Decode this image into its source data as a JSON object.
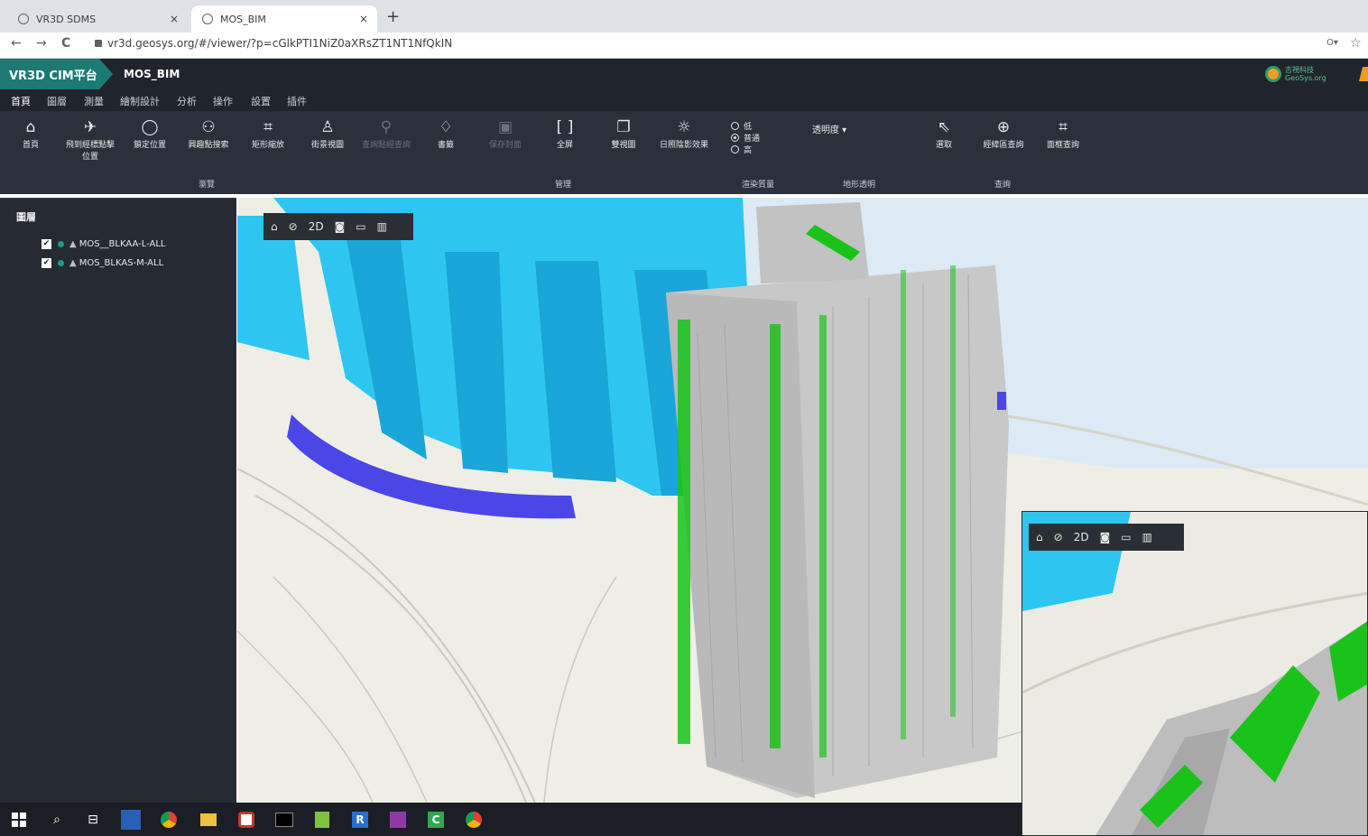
{
  "browser": {
    "tabs": [
      {
        "title": "VR3D SDMS",
        "icon": "globe-icon"
      },
      {
        "title": "MOS_BIM",
        "icon": "globe-icon"
      }
    ],
    "close_glyph": "×",
    "new_tab_glyph": "+",
    "url": "vr3d.geosys.org/#/viewer/?p=cGlkPTI1NiZ0aXRsZT1NT1NfQkIN",
    "back_glyph": "←",
    "forward_glyph": "→",
    "reload_glyph": "C",
    "key_glyph": "O▾",
    "star_glyph": "☆"
  },
  "app": {
    "brand": "VR3D CIM平台",
    "project": "MOS_BIM",
    "logo_text_top": "吉視科技",
    "logo_text_bottom": "GeoSys.org"
  },
  "menu": [
    "首頁",
    "圖層",
    "測量",
    "繪制設計",
    "分析",
    "操作",
    "設置",
    "插件"
  ],
  "toolbar": {
    "tools": [
      {
        "label": "首頁",
        "icon": "home-icon",
        "glyph": "⌂"
      },
      {
        "label": "飛到經標點擊位置",
        "icon": "send-icon",
        "glyph": "✈"
      },
      {
        "label": "鎖定位置",
        "icon": "lock-icon",
        "glyph": "🔒"
      },
      {
        "label": "興趣點搜索",
        "icon": "binoculars-icon",
        "glyph": "⚯"
      },
      {
        "label": "矩形縮放",
        "icon": "rect-zoom-icon",
        "glyph": "⌗"
      },
      {
        "label": "街景視圖",
        "icon": "person-icon",
        "glyph": "♙"
      },
      {
        "label": "查詢點經查詢",
        "icon": "nodes-icon",
        "glyph": "⚲"
      },
      {
        "label": "書籤",
        "icon": "tag-icon",
        "glyph": "⌂"
      },
      {
        "label": "保存封面",
        "icon": "save-icon",
        "glyph": "▣"
      },
      {
        "label": "全屏",
        "icon": "fullscreen-icon",
        "glyph": "⛶"
      },
      {
        "label": "雙視圖",
        "icon": "dual-view-icon",
        "glyph": "❐"
      },
      {
        "label": "日照陰影效果",
        "icon": "sun-icon",
        "glyph": "☼"
      },
      {
        "label": "選取",
        "icon": "pointer-icon",
        "glyph": "⇖"
      },
      {
        "label": "經緯區查詢",
        "icon": "globe-query-icon",
        "glyph": "⊕"
      },
      {
        "label": "面框查詢",
        "icon": "rect-query-icon",
        "glyph": "⌗"
      }
    ],
    "quality_options": [
      "低",
      "普通",
      "高"
    ],
    "quality_selected": "普通",
    "transparency_label": "透明度 ▾",
    "groups": [
      "瀏覽",
      "管理",
      "渲染質量",
      "地形透明",
      "查詢"
    ]
  },
  "sidebar": {
    "title": "圖層",
    "layers": [
      {
        "name": "MOS__BLKAA-L-ALL",
        "checked": true
      },
      {
        "name": "MOS_BLKAS-M-ALL",
        "checked": true
      }
    ]
  },
  "viewer_toolbar": {
    "items": [
      {
        "icon": "home-icon",
        "glyph": "⌂"
      },
      {
        "icon": "compass-icon",
        "glyph": "⊘"
      },
      {
        "icon": "2d-toggle",
        "glyph": "2D"
      },
      {
        "icon": "camera-icon",
        "glyph": "◙"
      },
      {
        "icon": "video-icon",
        "glyph": "▭"
      },
      {
        "icon": "trash-icon",
        "glyph": "▥"
      }
    ]
  },
  "colors": {
    "brand": "#1d7a73",
    "header": "#20252d",
    "toolbar": "#2b313a",
    "sidebar": "#262b33",
    "bim_highlight": "#19c319",
    "buildings_cyan": "#29c8f0",
    "buildings_blue": "#4b46e6"
  }
}
